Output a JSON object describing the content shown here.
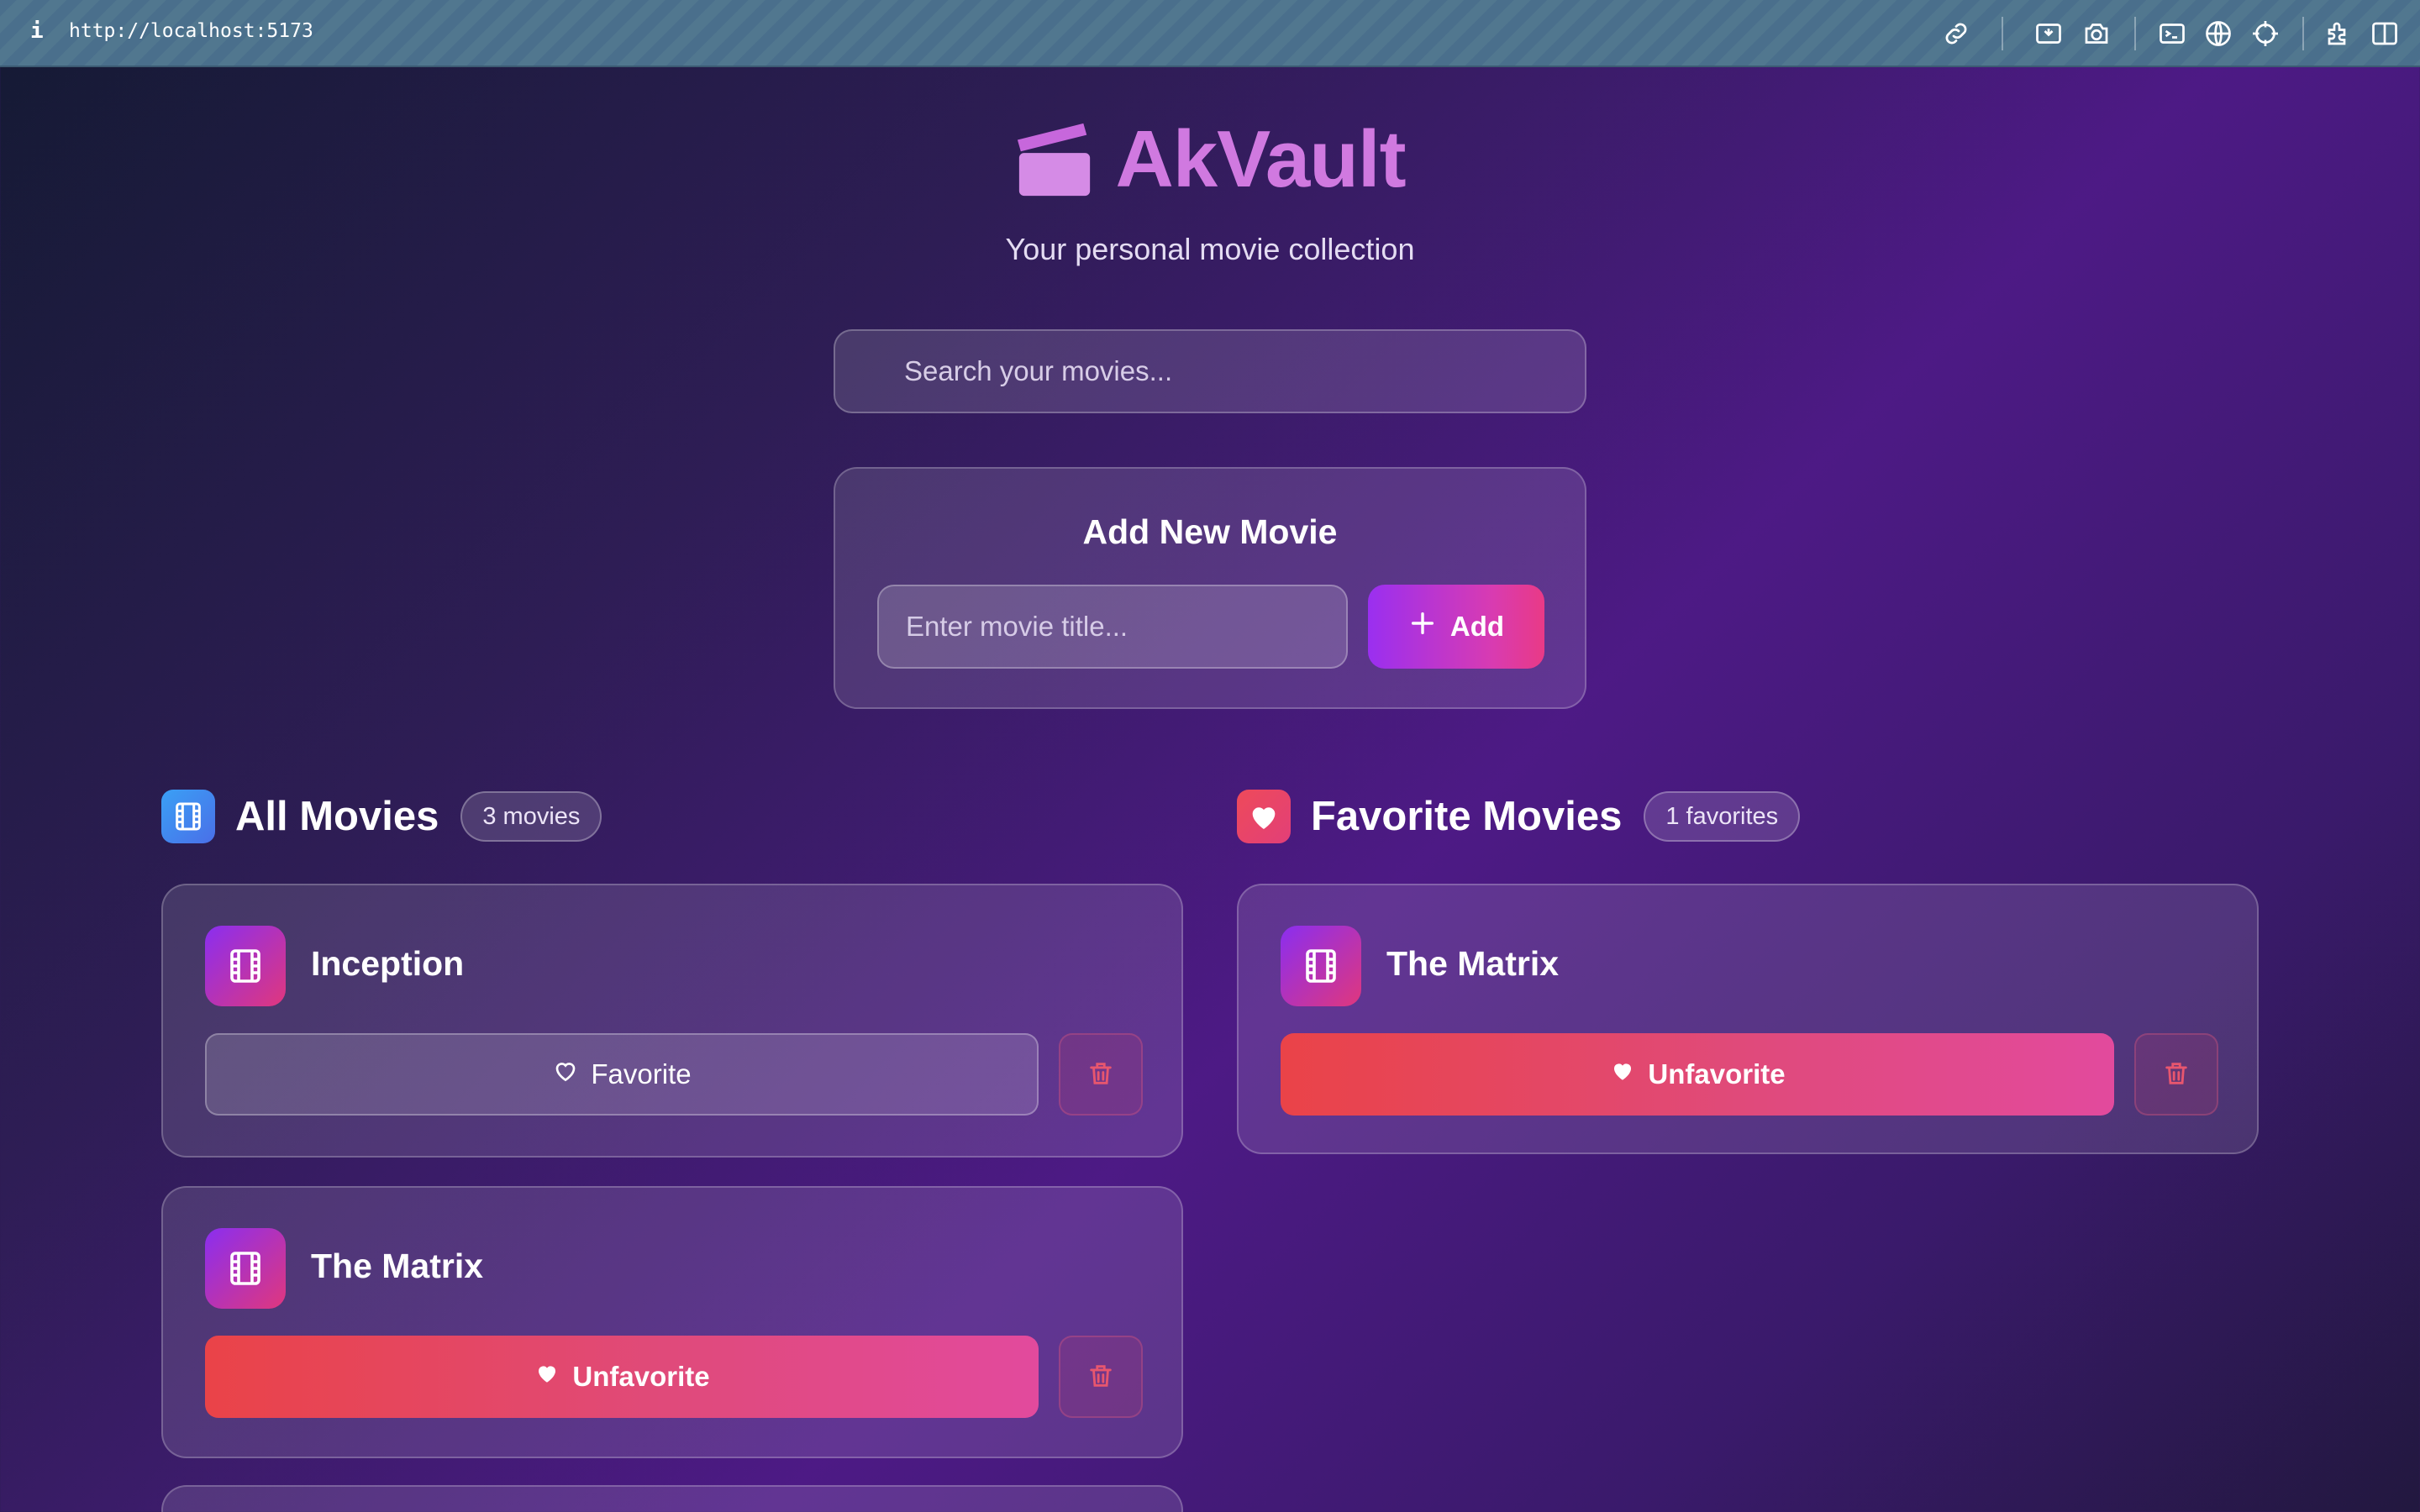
{
  "browser": {
    "info_glyph": "i",
    "url": "http://localhost:5173"
  },
  "header": {
    "title": "AkVault",
    "subtitle": "Your personal movie collection",
    "logo_icon": "clapperboard-icon"
  },
  "search": {
    "placeholder": "Search your movies..."
  },
  "add_movie": {
    "title": "Add New Movie",
    "input_placeholder": "Enter movie title...",
    "button_label": "Add"
  },
  "all_movies": {
    "title": "All Movies",
    "count": "3 movies",
    "items": [
      {
        "title": "Inception",
        "favorite_label": "Favorite",
        "is_favorite": false
      },
      {
        "title": "The Matrix",
        "favorite_label": "Unfavorite",
        "is_favorite": true
      }
    ]
  },
  "favorite_movies": {
    "title": "Favorite Movies",
    "count": "1 favorites",
    "items": [
      {
        "title": "The Matrix",
        "favorite_label": "Unfavorite",
        "is_favorite": true
      }
    ]
  },
  "colors": {
    "brand": "#d079e0",
    "accent_gradient_start": "#9a2ff0",
    "accent_gradient_end": "#e93a86",
    "favorite_red": "#ea4348",
    "all_movies_icon_bg": "#3b8ff0",
    "favorites_icon_bg": "#ee4060"
  }
}
